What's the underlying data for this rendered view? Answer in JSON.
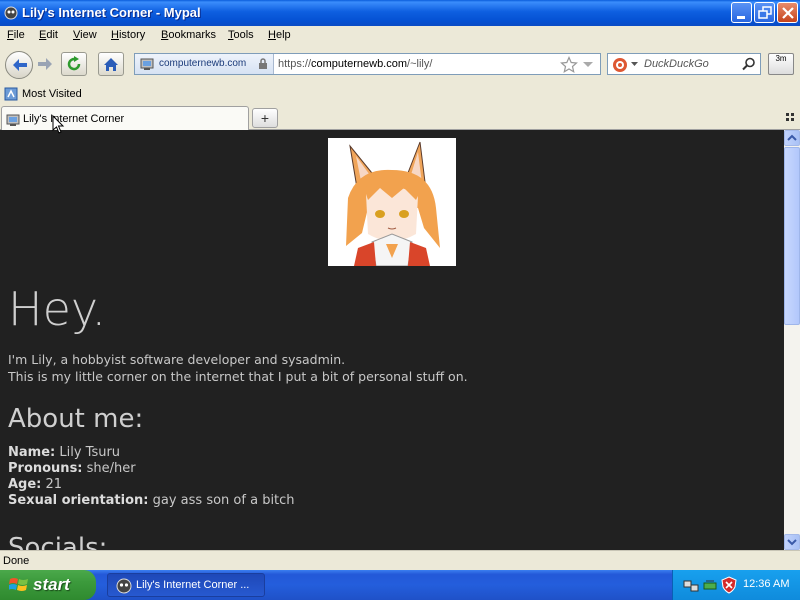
{
  "window": {
    "title": "Lily's Internet Corner - Mypal"
  },
  "menu": [
    {
      "key": "F",
      "rest": "ile"
    },
    {
      "key": "E",
      "rest": "dit"
    },
    {
      "key": "V",
      "rest": "iew"
    },
    {
      "key": "H",
      "rest": "istory"
    },
    {
      "key": "B",
      "rest": "ookmarks"
    },
    {
      "key": "T",
      "rest": "ools"
    },
    {
      "key": "H",
      "rest": "elp"
    }
  ],
  "nav": {
    "site_identity": "computernewb.com",
    "url_prefix": "https://",
    "url_host": "computernewb.com",
    "url_path": "/~lily/",
    "search_placeholder": "DuckDuckGo",
    "ext_label": "3m"
  },
  "bookmarks": {
    "most_visited": "Most Visited"
  },
  "tabs": [
    {
      "label": "Lily's Internet Corner"
    }
  ],
  "page": {
    "heading": "Hey.",
    "intro_line1": "I'm Lily, a hobbyist software developer and sysadmin.",
    "intro_line2": "This is my little corner on the internet that I put a bit of personal stuff on.",
    "about_heading": "About me:",
    "facts": [
      {
        "label": "Name:",
        "value": "Lily Tsuru"
      },
      {
        "label": "Pronouns:",
        "value": "she/her"
      },
      {
        "label": "Age:",
        "value": "21"
      },
      {
        "label": "Sexual orientation:",
        "value": "gay ass son of a bitch"
      }
    ],
    "socials_heading": "Socials:"
  },
  "status": {
    "text": "Done"
  },
  "taskbar": {
    "start_label": "start",
    "task_label": "Lily's Internet Corner ...",
    "clock": "12:36 AM"
  },
  "colors": {
    "page_bg": "#212121",
    "page_text": "#cccccc",
    "title_bar": "#0a5ddb",
    "taskbar": "#245edc",
    "start_green": "#3c9a3c"
  }
}
